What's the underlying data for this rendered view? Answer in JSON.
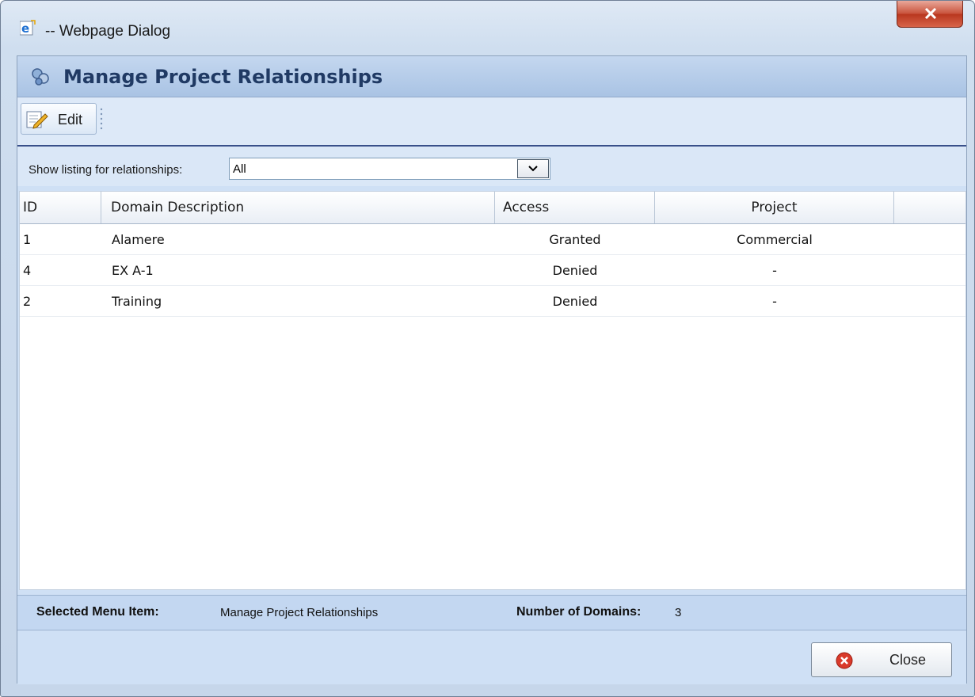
{
  "window": {
    "title": "-- Webpage Dialog"
  },
  "header": {
    "title": "Manage Project Relationships"
  },
  "toolbar": {
    "edit_label": "Edit"
  },
  "filter": {
    "label": "Show listing for relationships:",
    "selected": "All"
  },
  "table": {
    "columns": [
      "ID",
      "Domain Description",
      "Access",
      "Project",
      ""
    ],
    "rows": [
      {
        "id": "1",
        "description": "Alamere",
        "access": "Granted",
        "project": "Commercial"
      },
      {
        "id": "4",
        "description": "EX A-1",
        "access": "Denied",
        "project": "-"
      },
      {
        "id": "2",
        "description": "Training",
        "access": "Denied",
        "project": "-"
      }
    ]
  },
  "status": {
    "selected_label": "Selected Menu Item:",
    "selected_value": "Manage Project Relationships",
    "count_label": "Number of Domains:",
    "count_value": "3"
  },
  "footer": {
    "close_label": "Close"
  },
  "colors": {
    "header_text": "#203a64",
    "close_icon": "#d93a2b",
    "window_close": "#c8513a"
  }
}
